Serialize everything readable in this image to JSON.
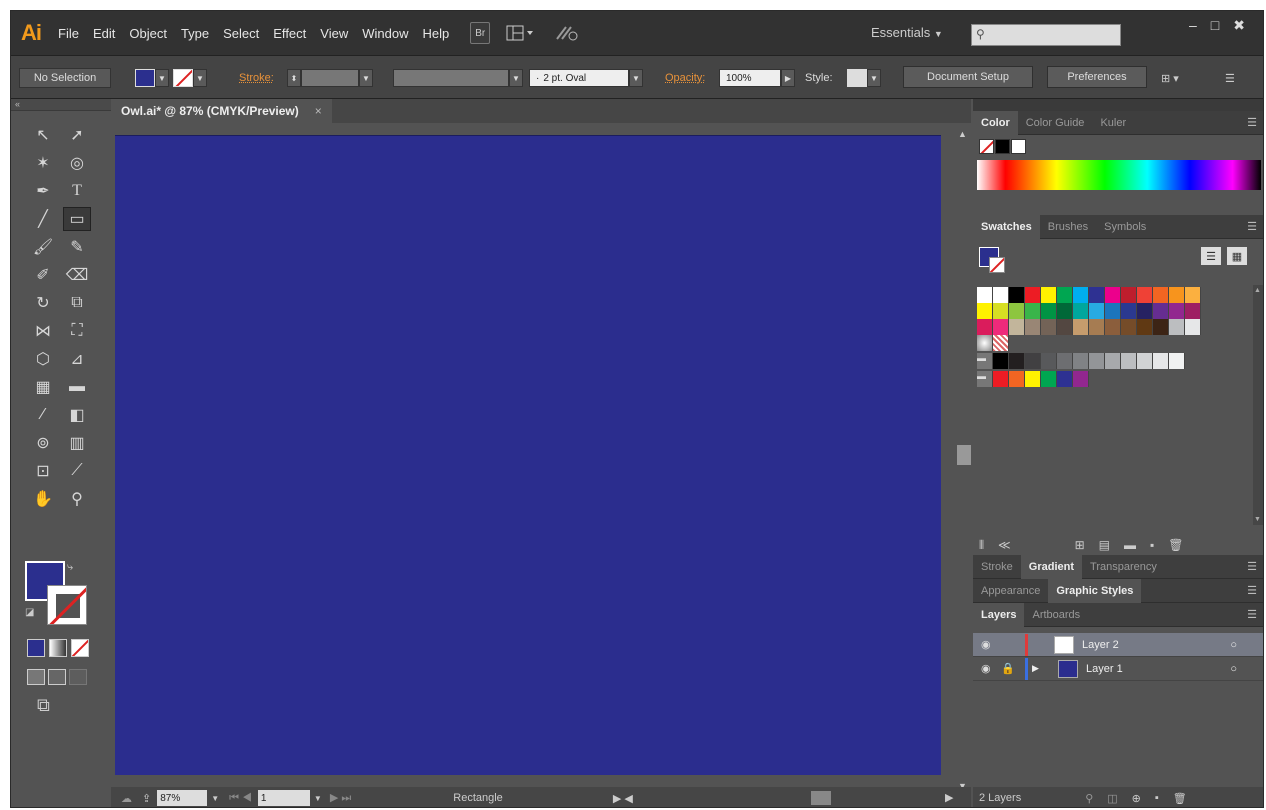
{
  "app": {
    "logo": "Ai",
    "window_controls": [
      "–",
      "□",
      "✖"
    ]
  },
  "menubar": {
    "items": [
      "File",
      "Edit",
      "Object",
      "Type",
      "Select",
      "Effect",
      "View",
      "Window",
      "Help"
    ],
    "bridge_label": "Br",
    "workspace": "Essentials",
    "search_placeholder": ""
  },
  "control_bar": {
    "selection": "No Selection",
    "stroke_label": "Stroke:",
    "brush": "2 pt. Oval",
    "opacity_label": "Opacity:",
    "opacity_value": "100%",
    "style_label": "Style:",
    "document_setup": "Document Setup",
    "preferences": "Preferences"
  },
  "document": {
    "tab_title": "Owl.ai* @ 87% (CMYK/Preview)",
    "close_glyph": "×",
    "artboard_color": "#2b2d8e"
  },
  "status_bar": {
    "zoom": "87%",
    "artboard_number": "1",
    "current_tool": "Rectangle"
  },
  "panels": {
    "color_tabs": [
      "Color",
      "Color Guide",
      "Kuler"
    ],
    "swatch_tabs": [
      "Swatches",
      "Brushes",
      "Symbols"
    ],
    "stroke_tabs": [
      "Stroke",
      "Gradient",
      "Transparency"
    ],
    "appearance_tabs": [
      "Appearance",
      "Graphic Styles"
    ],
    "layers_tabs": [
      "Layers",
      "Artboards"
    ],
    "layers": [
      {
        "name": "Layer 2",
        "color": "#e03a3a",
        "thumb": "#ffffff"
      },
      {
        "name": "Layer 1",
        "color": "#3a6fe0",
        "thumb": "#2b2d8e"
      }
    ],
    "layers_count": "2 Layers"
  },
  "swatches": {
    "row1": [
      "#ffffff",
      "#ffffff",
      "#000000",
      "#ed1c24",
      "#fff200",
      "#00a651",
      "#00aeef",
      "#2e3192",
      "#ec008c",
      "#be1e2d",
      "#ef4136",
      "#f26522",
      "#f7941d",
      "#fbb040"
    ],
    "row2": [
      "#fff200",
      "#d7df23",
      "#8dc63f",
      "#39b54a",
      "#009444",
      "#006838",
      "#00a79d",
      "#27aae1",
      "#1c75bc",
      "#2b3990",
      "#262262",
      "#662d91",
      "#92278f",
      "#9e1f63"
    ],
    "row3": [
      "#da1c5c",
      "#ee2a7b",
      "#c2b59b",
      "#998675",
      "#736357",
      "#534741",
      "#c69c6d",
      "#a67c52",
      "#8b5e3c",
      "#754c29",
      "#603913",
      "#3c2415",
      "#bcbec0",
      "#e6e7e8"
    ],
    "row5": [
      "#000000",
      "#231f20",
      "#414042",
      "#58595b",
      "#6d6e71",
      "#808285",
      "#939598",
      "#a7a9ac",
      "#bcbec0",
      "#d1d3d4",
      "#e6e7e8",
      "#f1f2f2"
    ],
    "row6": [
      "#ed1c24",
      "#f26522",
      "#fff200",
      "#00a651",
      "#2e3192",
      "#92278f"
    ]
  }
}
